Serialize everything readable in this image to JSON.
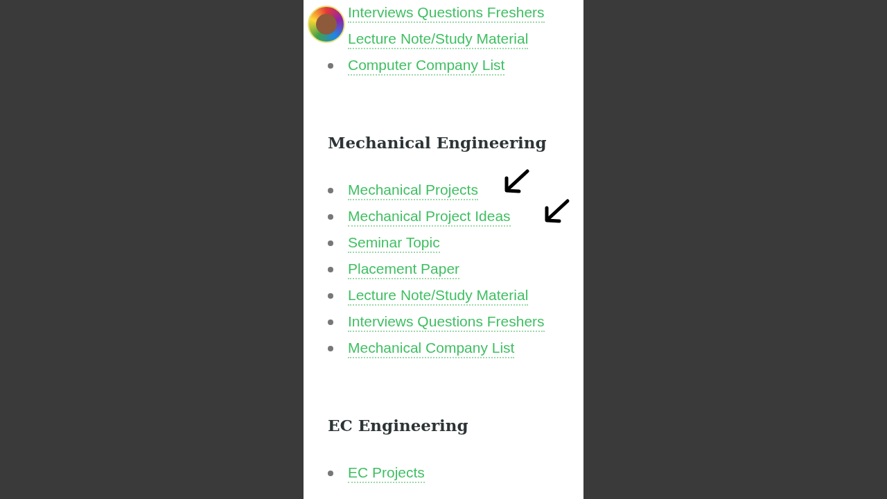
{
  "sections": [
    {
      "links": [
        "Interviews Questions Freshers",
        "Lecture Note/Study Material",
        "Computer Company List"
      ]
    },
    {
      "heading": "Mechanical Engineering",
      "links": [
        "Mechanical Projects",
        "Mechanical Project Ideas",
        "Seminar Topic",
        "Placement Paper",
        "Lecture Note/Study Material",
        "Interviews Questions Freshers",
        "Mechanical Company List"
      ]
    },
    {
      "heading": "EC Engineering",
      "links": [
        "EC Projects"
      ]
    }
  ]
}
